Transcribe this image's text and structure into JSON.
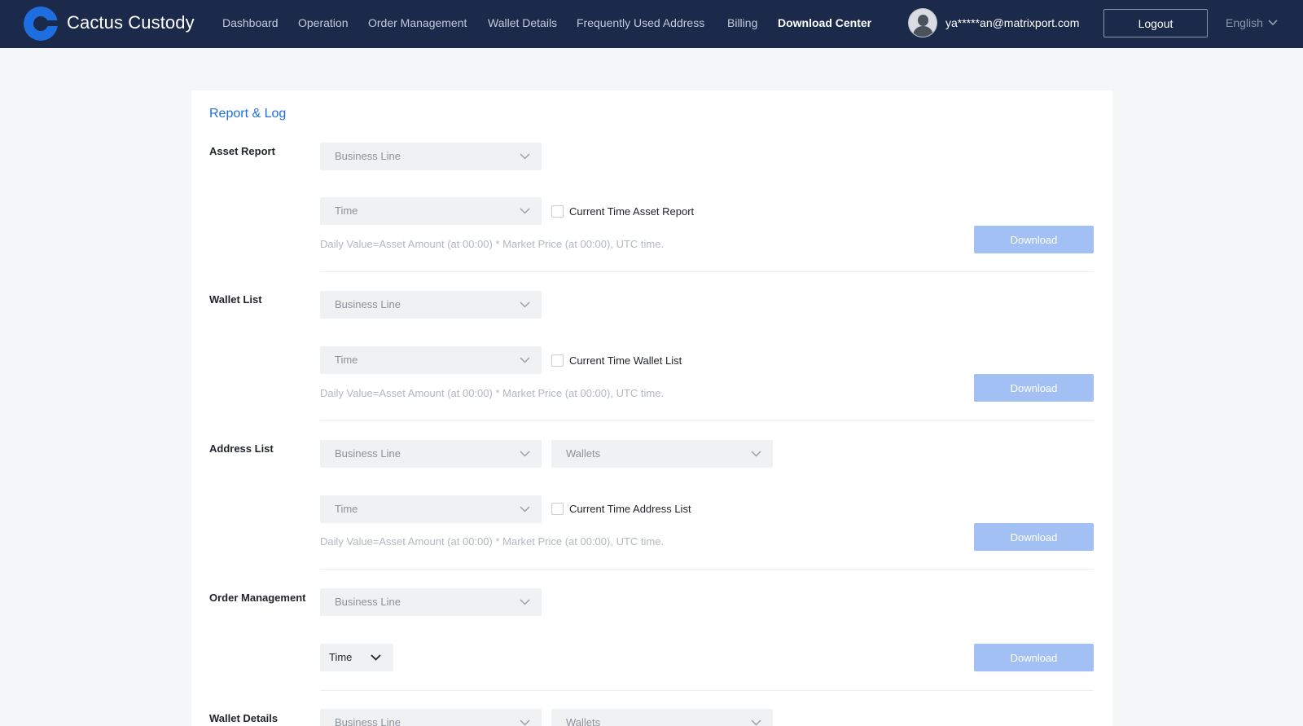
{
  "header": {
    "brand": "Cactus Custody",
    "nav": [
      {
        "label": "Dashboard",
        "active": false
      },
      {
        "label": "Operation",
        "active": false
      },
      {
        "label": "Order Management",
        "active": false
      },
      {
        "label": "Wallet Details",
        "active": false
      },
      {
        "label": "Frequently Used Address",
        "active": false
      },
      {
        "label": "Billing",
        "active": false
      },
      {
        "label": "Download Center",
        "active": true
      }
    ],
    "user_email": "ya*****an@matrixport.com",
    "logout_label": "Logout",
    "language": "English"
  },
  "page": {
    "title": "Report & Log"
  },
  "sections": {
    "asset_report": {
      "label": "Asset Report",
      "business_line": "Business Line",
      "time": "Time",
      "checkbox_label": "Current Time Asset Report",
      "hint": "Daily Value=Asset Amount (at 00:00) * Market Price (at 00:00), UTC time.",
      "download": "Download"
    },
    "wallet_list": {
      "label": "Wallet List",
      "business_line": "Business Line",
      "time": "Time",
      "checkbox_label": "Current Time Wallet List",
      "hint": "Daily Value=Asset Amount (at 00:00) * Market Price (at 00:00), UTC time.",
      "download": "Download"
    },
    "address_list": {
      "label": "Address List",
      "business_line": "Business Line",
      "wallets": "Wallets",
      "time": "Time",
      "checkbox_label": "Current Time Address List",
      "hint": "Daily Value=Asset Amount (at 00:00) * Market Price (at 00:00), UTC time.",
      "download": "Download"
    },
    "order_management": {
      "label": "Order Management",
      "business_line": "Business Line",
      "time": "Time",
      "download": "Download"
    },
    "wallet_details": {
      "label": "Wallet Details",
      "business_line": "Business Line",
      "wallets": "Wallets"
    }
  },
  "colors": {
    "header_bg": "#1b2a4a",
    "accent": "#1f6ee0",
    "download_disabled": "#a3c0f5"
  }
}
